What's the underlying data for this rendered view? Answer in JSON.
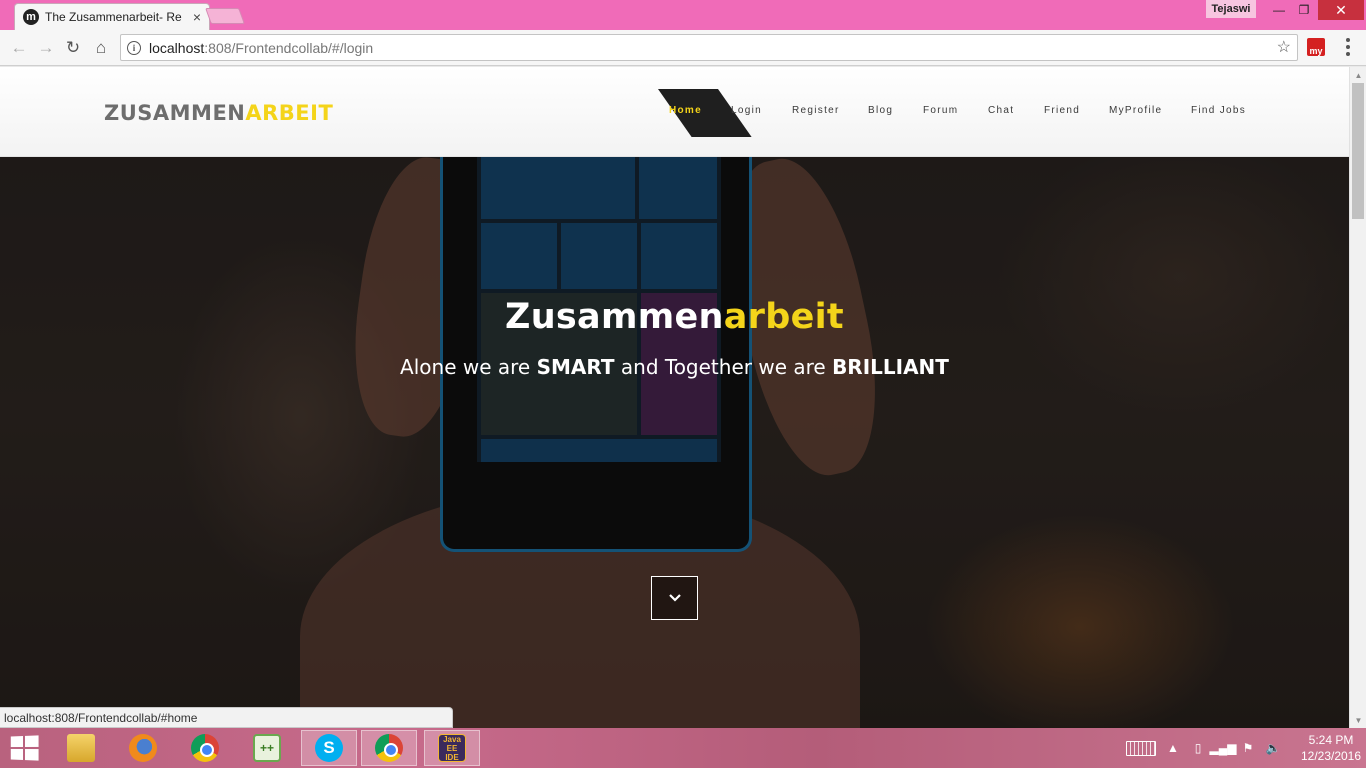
{
  "browser": {
    "tab_title": "The Zusammenarbeit- Re",
    "tab_favicon_letter": "m",
    "profile_name": "Tejaswi",
    "url_host": "localhost",
    "url_rest": ":808/Frontendcollab/#/login",
    "extension_label": "my",
    "status_url": "localhost:808/Frontendcollab/#home"
  },
  "site": {
    "logo_part1": "ZUSAMMEN",
    "logo_part2": "ARBEIT",
    "nav": [
      "Home",
      "Login",
      "Register",
      "Blog",
      "Forum",
      "Chat",
      "Friend",
      "MyProfile",
      "Find Jobs"
    ],
    "active_nav": "Home"
  },
  "hero": {
    "title_part1": "Zusammen",
    "title_part2": "arbeit",
    "sub_1": "Alone we are ",
    "sub_2": "SMART",
    "sub_3": " and Together we are ",
    "sub_4": "BRILLIANT"
  },
  "taskbar": {
    "apps": [
      "file-explorer",
      "firefox",
      "chrome",
      "notepad-plus-plus",
      "skype",
      "chrome",
      "eclipse-java-ee-ide"
    ],
    "eclipse_label": "Java EE IDE",
    "time": "5:24 PM",
    "date": "12/23/2016"
  },
  "colors": {
    "accent_yellow": "#f4d41a",
    "titlebar_pink": "#f06bb8",
    "taskbar_pink": "#c76a8b"
  }
}
